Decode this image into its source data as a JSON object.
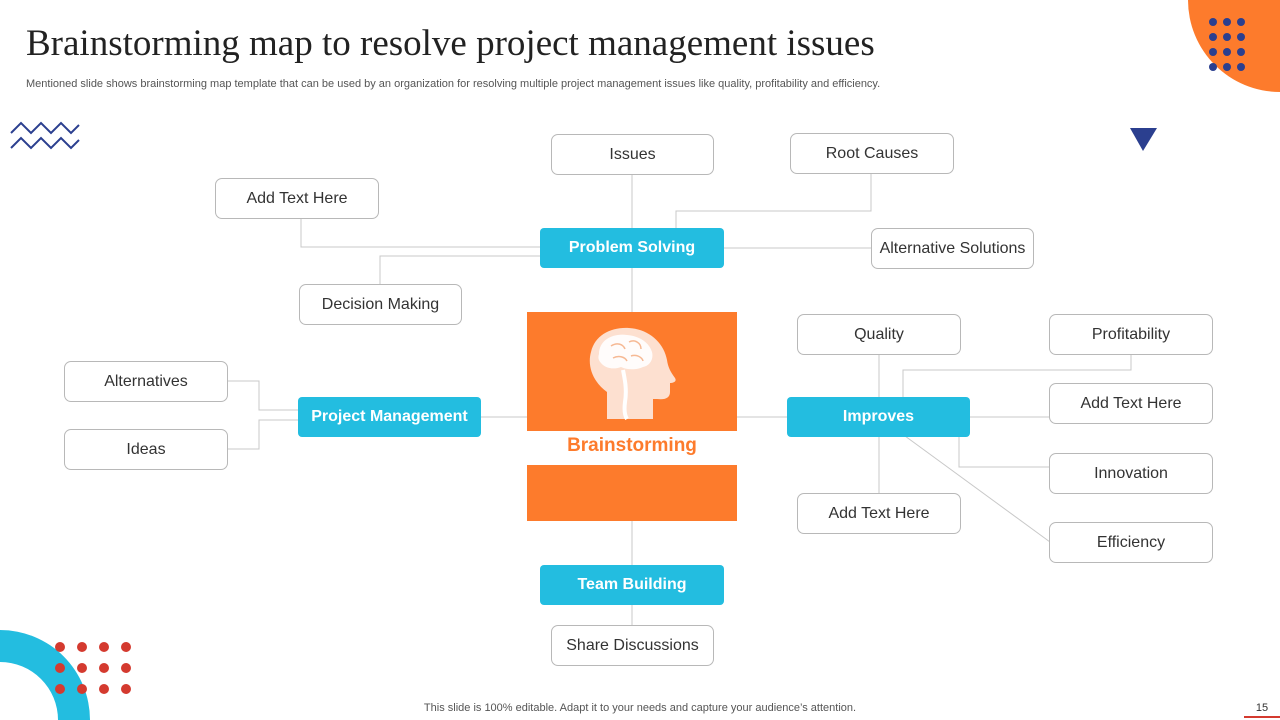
{
  "slide": {
    "title": "Brainstorming map to resolve project management issues",
    "subtitle": "Mentioned slide shows brainstorming map template that can be used by an organization for resolving multiple project management issues like quality, profitability and efficiency.",
    "footer": "This slide is 100% editable. Adapt it to your needs and capture your audience’s attention.",
    "page_number": "15"
  },
  "center": {
    "label": "Brainstorming",
    "icon": "brain-head-icon",
    "color": "#fd7b2c"
  },
  "hubs": {
    "problem_solving": "Problem Solving",
    "project_management": "Project Management",
    "improves": "Improves",
    "team_building": "Team Building"
  },
  "nodes": {
    "issues": "Issues",
    "root_causes": "Root Causes",
    "add_text_1": "Add Text Here",
    "alternative_solutions": "Alternative Solutions",
    "decision_making": "Decision Making",
    "alternatives": "Alternatives",
    "ideas": "Ideas",
    "quality": "Quality",
    "profitability": "Profitability",
    "add_text_2": "Add Text Here",
    "innovation": "Innovation",
    "efficiency": "Efficiency",
    "add_text_3": "Add Text Here",
    "share_discussions": "Share Discussions"
  },
  "colors": {
    "hub": "#23bde0",
    "accent_orange": "#fd7b2c",
    "accent_navy": "#2b3f8f",
    "accent_red": "#d43a2f"
  }
}
